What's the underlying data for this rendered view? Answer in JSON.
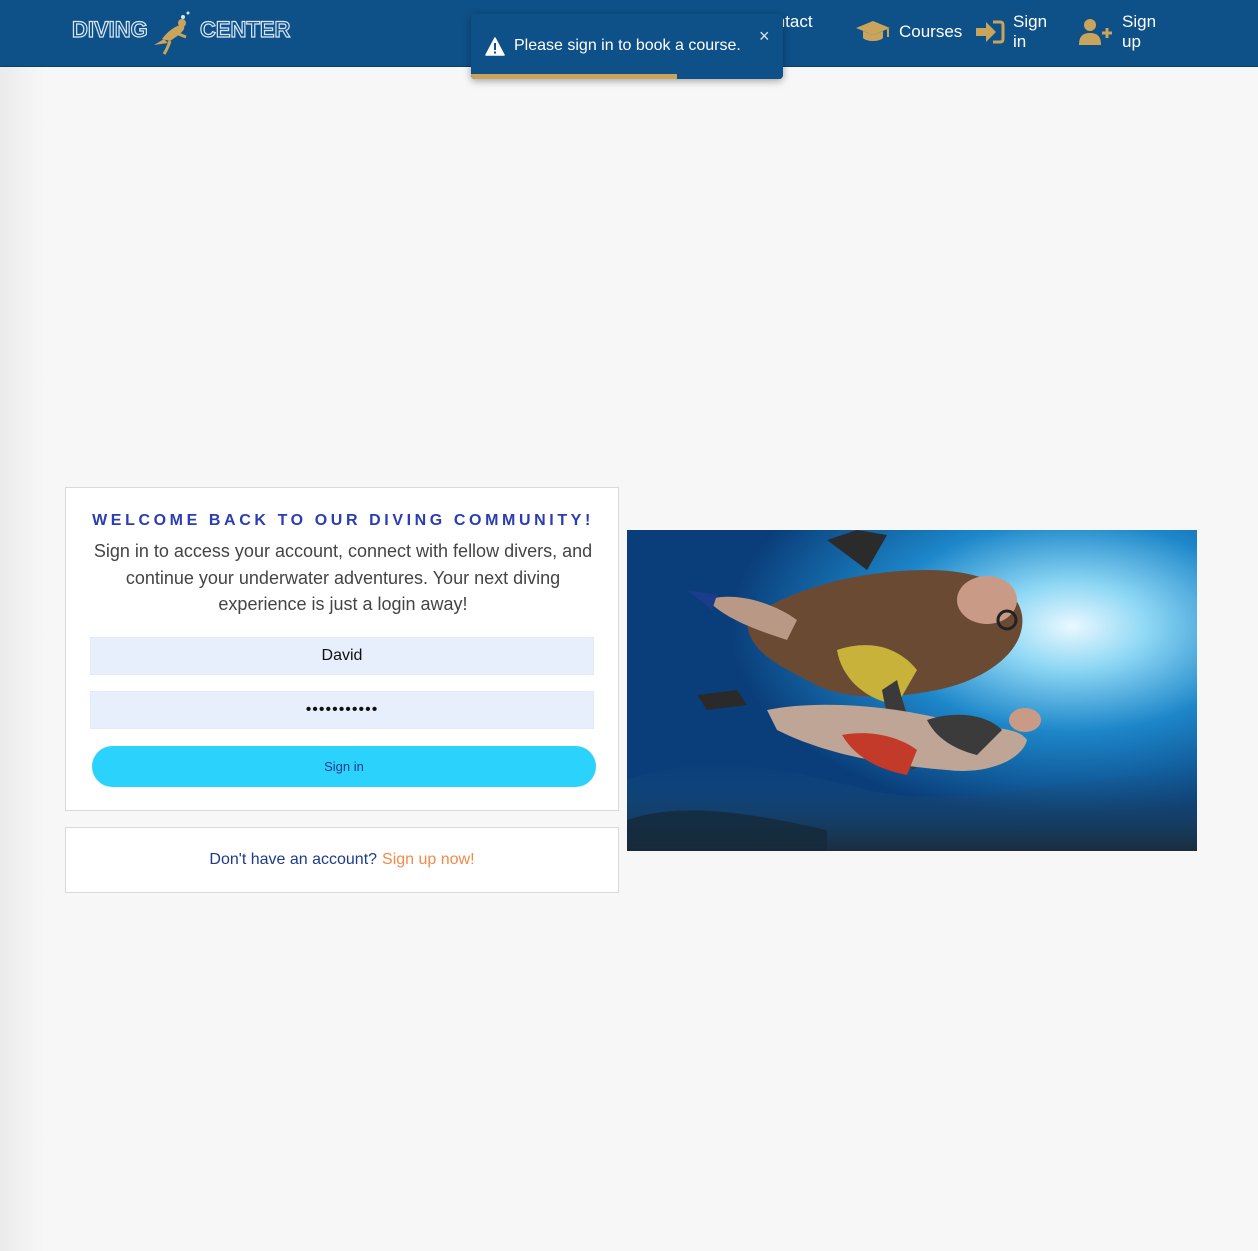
{
  "navbar": {
    "logo": {
      "word1": "DIVING",
      "word2": "CENTER"
    },
    "items": [
      {
        "label": "Contact Us",
        "icon": "envelope-icon"
      },
      {
        "label": "Courses",
        "icon": "graduation-cap-icon"
      },
      {
        "label": "Sign in",
        "icon": "sign-in-icon"
      },
      {
        "label": "Sign up",
        "icon": "user-plus-icon"
      }
    ]
  },
  "toast": {
    "message": "Please sign in to book a course.",
    "close_symbol": "×",
    "icon": "warning-icon",
    "progress": 0.66
  },
  "login": {
    "title": "WELCOME BACK TO OUR DIVING COMMUNITY!",
    "text": "Sign in to access your account, connect with fellow divers, and continue your underwater adventures. Your next diving experience is just a login away!",
    "username_value": "David",
    "password_value": "•••••••••••",
    "signin_label": "Sign in"
  },
  "signup": {
    "question": "Don't have an account?",
    "link": "Sign up now!"
  },
  "photo": {
    "subject": "scuba-divers-underwater"
  },
  "colors": {
    "navbar": "#0e5088",
    "accent_gold": "#c9a45c",
    "title_blue": "#2a3db3",
    "button_cyan": "#2bd3fc",
    "link_orange": "#f28a4a"
  }
}
